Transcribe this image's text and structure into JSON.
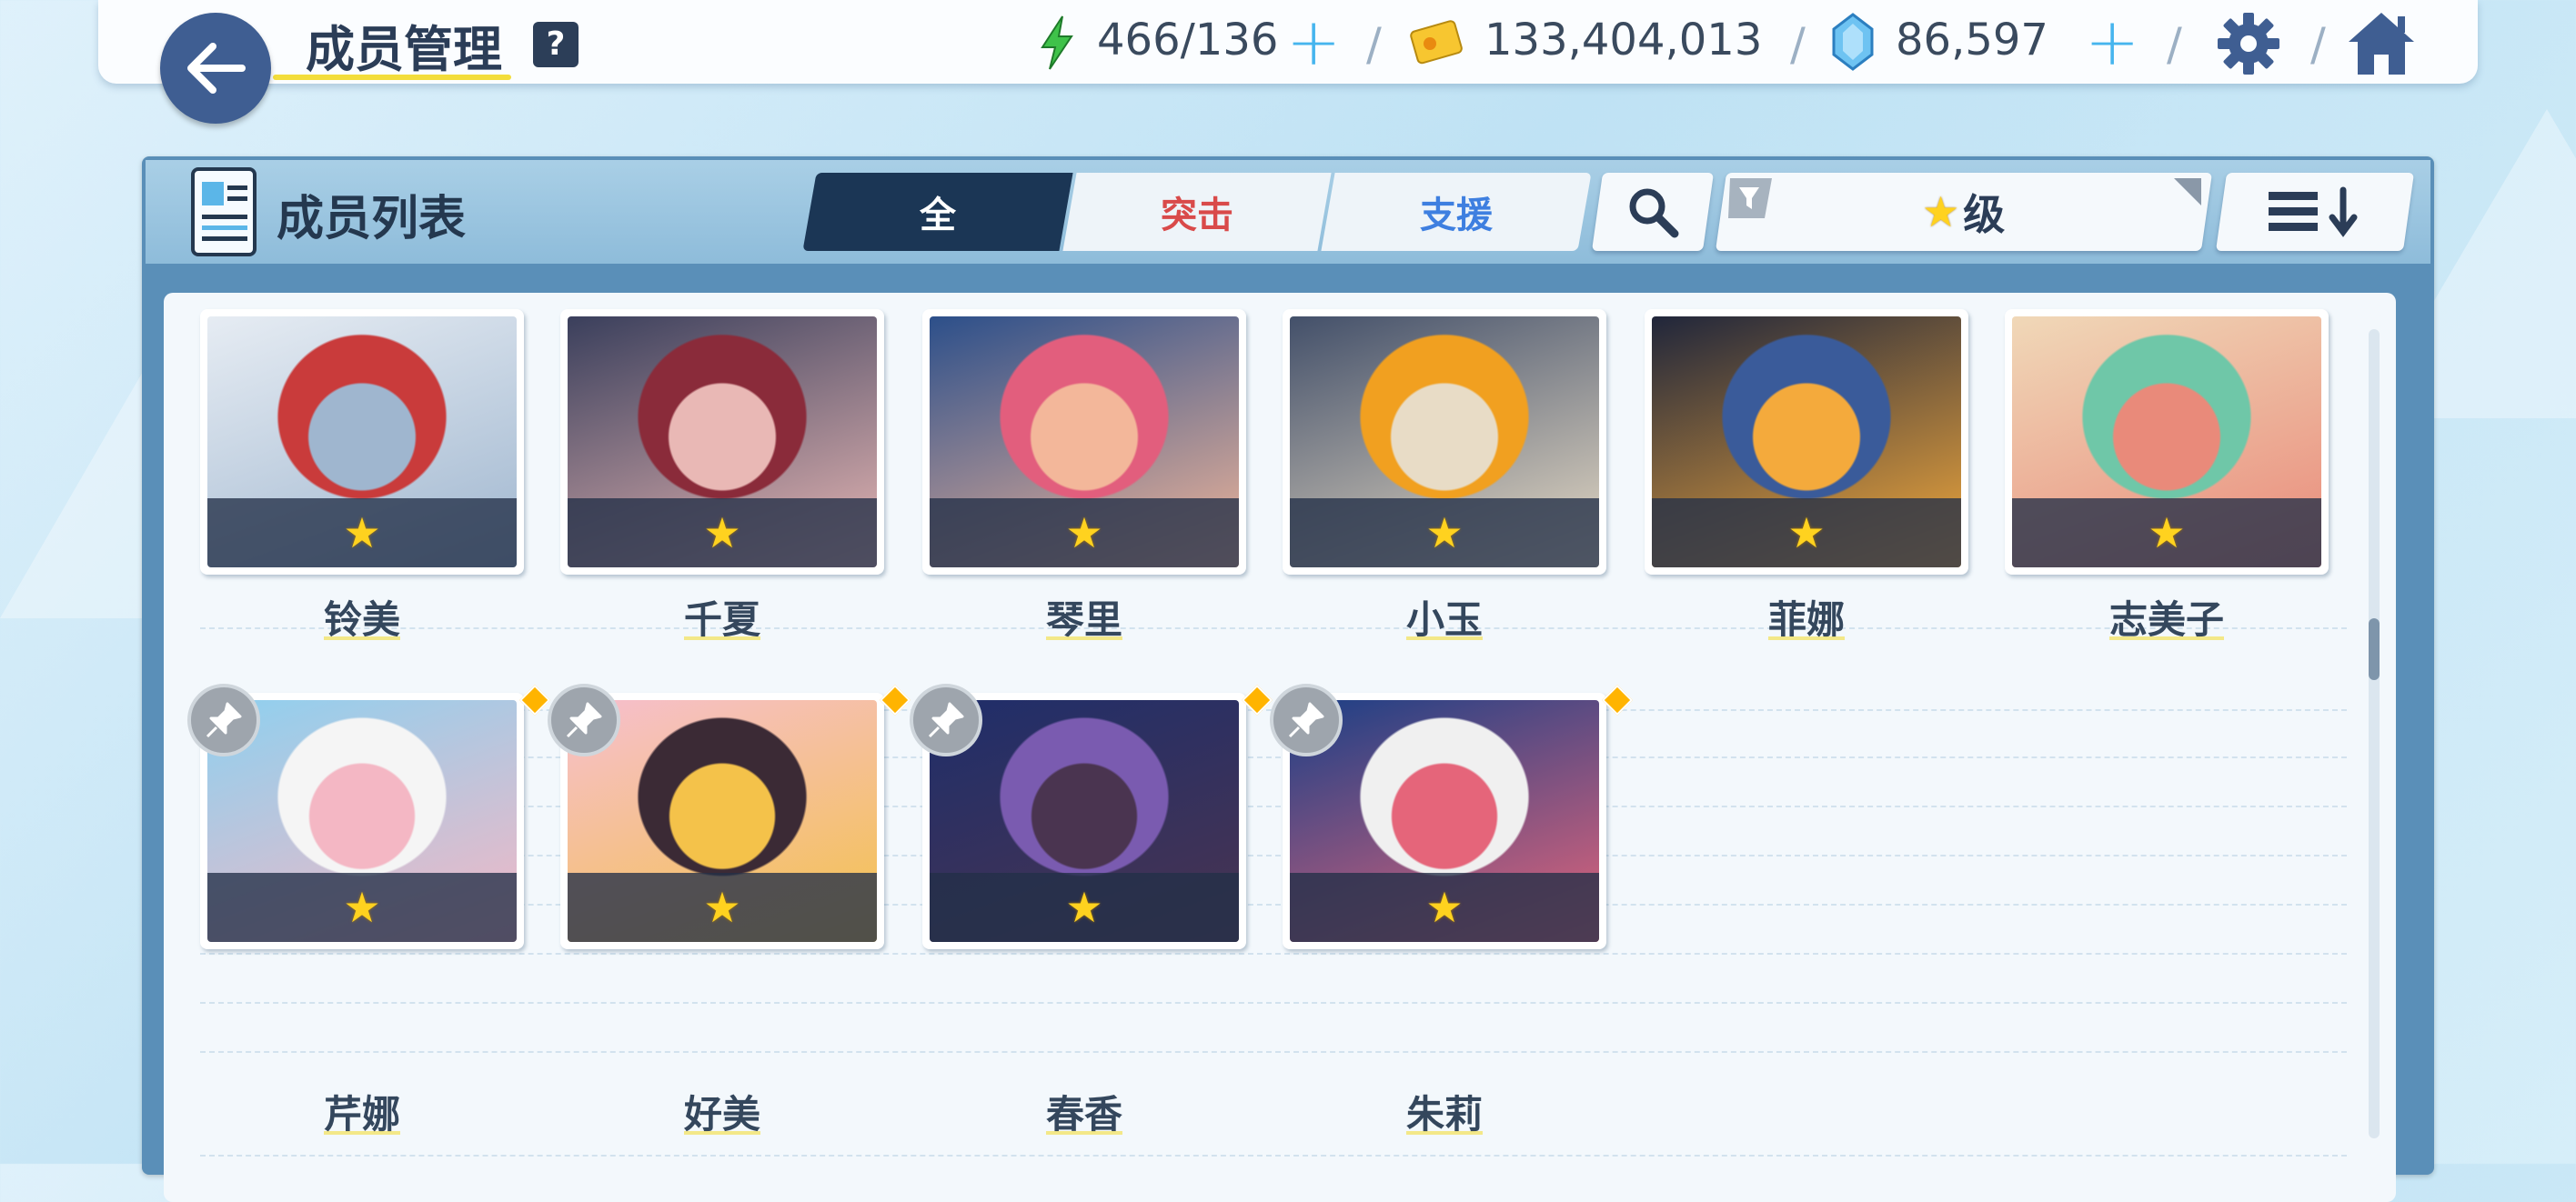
{
  "header": {
    "title": "成员管理",
    "help_label": "?",
    "stamina": "466/136",
    "credits": "133,404,013",
    "gems": "86,597",
    "separator": "/",
    "plus": "+"
  },
  "panel": {
    "title": "成员列表",
    "tabs": [
      {
        "label": "全",
        "active": true,
        "color": "#ffffff"
      },
      {
        "label": "突击",
        "active": false,
        "color": "#d94a4a"
      },
      {
        "label": "支援",
        "active": false,
        "color": "#3e7fe0"
      }
    ],
    "sort_label": "级",
    "sort_star": "★"
  },
  "members": [
    {
      "name": "铃美",
      "stars": 1,
      "pinned": false,
      "new": false,
      "palette": [
        "#e6ecf3",
        "#9fb6cf",
        "#c93b3b"
      ]
    },
    {
      "name": "千夏",
      "stars": 1,
      "pinned": false,
      "new": false,
      "palette": [
        "#3a3f5c",
        "#e9b8b5",
        "#8a2b3a"
      ]
    },
    {
      "name": "琴里",
      "stars": 1,
      "pinned": false,
      "new": false,
      "palette": [
        "#2c4f8a",
        "#f3b79a",
        "#e25e7d"
      ]
    },
    {
      "name": "小玉",
      "stars": 1,
      "pinned": false,
      "new": false,
      "palette": [
        "#43506a",
        "#e8dcc6",
        "#f1a020"
      ]
    },
    {
      "name": "菲娜",
      "stars": 1,
      "pinned": false,
      "new": false,
      "palette": [
        "#20263b",
        "#f4aa3c",
        "#3a5b9a"
      ]
    },
    {
      "name": "志美子",
      "stars": 1,
      "pinned": false,
      "new": false,
      "palette": [
        "#f0d8b8",
        "#e98a7a",
        "#6fc7a8"
      ]
    },
    {
      "name": "芹娜",
      "stars": 1,
      "pinned": true,
      "new": true,
      "palette": [
        "#8fd0ef",
        "#f4b7c4",
        "#f5f5f5"
      ]
    },
    {
      "name": "好美",
      "stars": 1,
      "pinned": true,
      "new": true,
      "palette": [
        "#f6bfcf",
        "#f4c24a",
        "#3b2a35"
      ]
    },
    {
      "name": "春香",
      "stars": 1,
      "pinned": true,
      "new": true,
      "palette": [
        "#1f2e6a",
        "#4a3450",
        "#7a5bb0"
      ]
    },
    {
      "name": "朱莉",
      "stars": 1,
      "pinned": true,
      "new": true,
      "palette": [
        "#1b3f86",
        "#e5657a",
        "#f0f0f0"
      ]
    }
  ]
}
